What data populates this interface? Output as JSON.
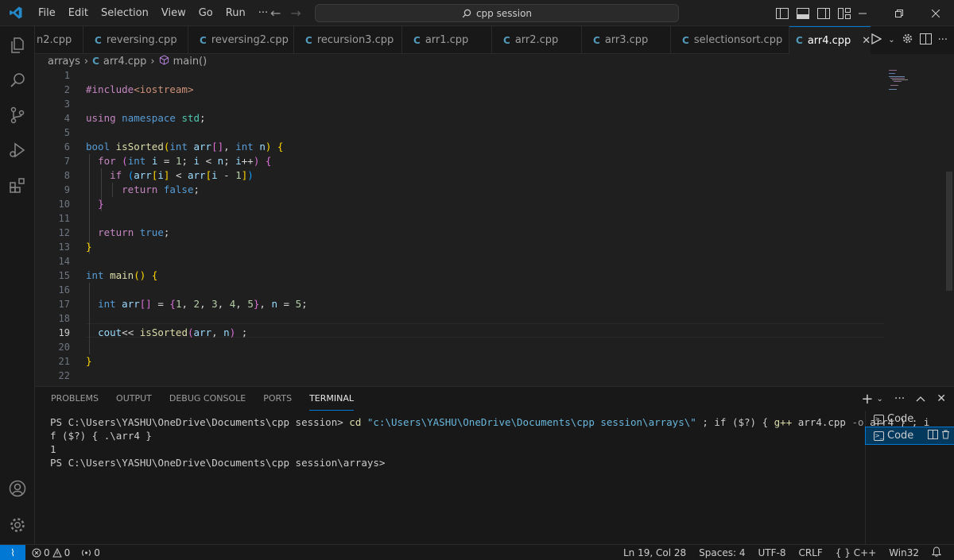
{
  "titlebar": {
    "menu": [
      "File",
      "Edit",
      "Selection",
      "View",
      "Go",
      "Run",
      "···"
    ],
    "search_text": "cpp session"
  },
  "tabs": [
    {
      "label": "n2.cpp",
      "active": false
    },
    {
      "label": "reversing.cpp",
      "active": false
    },
    {
      "label": "reversing2.cpp",
      "active": false
    },
    {
      "label": "recursion3.cpp",
      "active": false
    },
    {
      "label": "arr1.cpp",
      "active": false
    },
    {
      "label": "arr2.cpp",
      "active": false
    },
    {
      "label": "arr3.cpp",
      "active": false
    },
    {
      "label": "selectionsort.cpp",
      "active": false
    },
    {
      "label": "arr4.cpp",
      "active": true
    }
  ],
  "breadcrumb": {
    "folder": "arrays",
    "file": "arr4.cpp",
    "symbol": "main()"
  },
  "editor": {
    "line_numbers": [
      "1",
      "2",
      "3",
      "4",
      "5",
      "6",
      "7",
      "8",
      "9",
      "10",
      "11",
      "12",
      "13",
      "14",
      "15",
      "16",
      "17",
      "18",
      "19",
      "20",
      "21",
      "22"
    ],
    "current_line": 19
  },
  "panel": {
    "tabs": [
      "PROBLEMS",
      "OUTPUT",
      "DEBUG CONSOLE",
      "PORTS",
      "TERMINAL"
    ],
    "active_tab": "TERMINAL",
    "terminal": {
      "line1_prompt": "PS C:\\Users\\YASHU\\OneDrive\\Documents\\cpp session> ",
      "line1_cd": "cd ",
      "line1_path": "\"c:\\Users\\YASHU\\OneDrive\\Documents\\cpp session\\arrays\\\"",
      "line1_mid": " ; if ($?) { ",
      "line1_gpp": "g++",
      "line1_args": " arr4.cpp ",
      "line1_flag": "-o",
      "line1_end": " arr4 } ; i",
      "line2": "f ($?) { .\\arr4 }",
      "line3": "1",
      "line4": "PS C:\\Users\\YASHU\\OneDrive\\Documents\\cpp session\\arrays>"
    },
    "terminal_list": [
      "Code",
      "Code"
    ]
  },
  "statusbar": {
    "errors": "0",
    "warnings": "0",
    "ports": "0",
    "position": "Ln 19, Col 28",
    "spaces": "Spaces: 4",
    "encoding": "UTF-8",
    "eol": "CRLF",
    "language": "C++",
    "platform": "Win32"
  }
}
